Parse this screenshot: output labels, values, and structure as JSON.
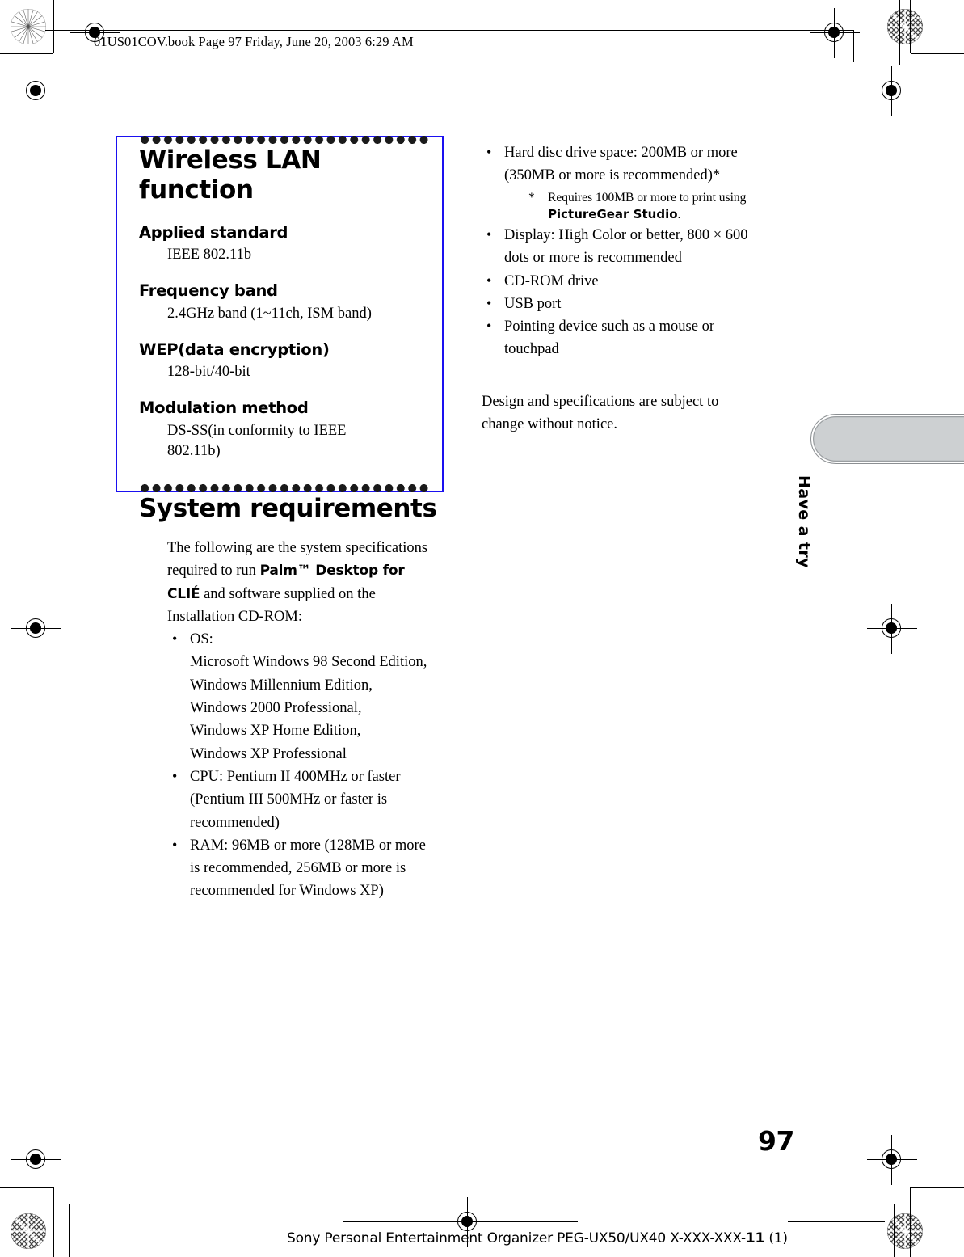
{
  "header": {
    "line": "01US01COV.book  Page 97  Friday, June 20, 2003  6:29 AM"
  },
  "colors": {
    "highlight_box_border": "#1a10f0",
    "tab_fill": "#cdd0d2",
    "tab_border": "#8b8f92",
    "text": "#000000"
  },
  "left_column": {
    "wireless_section": {
      "title": "Wireless LAN function",
      "specs": [
        {
          "label": "Applied standard",
          "value": "IEEE 802.11b"
        },
        {
          "label": "Frequency band",
          "value": "2.4GHz band (1~11ch, ISM band)"
        },
        {
          "label": "WEP(data encryption)",
          "value": "128-bit/40-bit"
        },
        {
          "label": "Modulation method",
          "value": "DS-SS(in conformity to IEEE 802.11b)"
        }
      ]
    },
    "system_section": {
      "title": "System requirements",
      "intro_part1": "The following are the system specifications required to run ",
      "intro_bold1": "Palm™ Desktop for CLIÉ",
      "intro_part2": " and software supplied on the Installation CD-ROM:",
      "bullets": [
        "OS:\nMicrosoft Windows 98 Second Edition,\nWindows Millennium Edition,\nWindows 2000 Professional,\nWindows XP Home Edition,\nWindows XP Professional",
        "CPU: Pentium II 400MHz or faster (Pentium III 500MHz or faster is recommended)",
        "RAM: 96MB or more (128MB or more is recommended, 256MB or more is recommended for Windows XP)"
      ]
    }
  },
  "right_column": {
    "bullet_hdd": "Hard disc drive space: 200MB or more (350MB or more is recommended)*",
    "footnote": {
      "marker": "*",
      "text_part1": "Requires 100MB or more to print using ",
      "bold": "PictureGear Studio",
      "text_part2": "."
    },
    "bullets": [
      "Display: High Color or better, 800 × 600 dots or more is recommended",
      "CD-ROM drive",
      "USB port",
      "Pointing device such as a mouse or touchpad"
    ],
    "closing": "Design and specifications are subject to change without notice."
  },
  "side_tab": {
    "label": "Have a try"
  },
  "page_number": "97",
  "footer": {
    "part1": "Sony Personal Entertainment Organizer  PEG-UX50/UX40  X-XXX-XXX-",
    "bold": "11",
    "part2": " (1)"
  }
}
